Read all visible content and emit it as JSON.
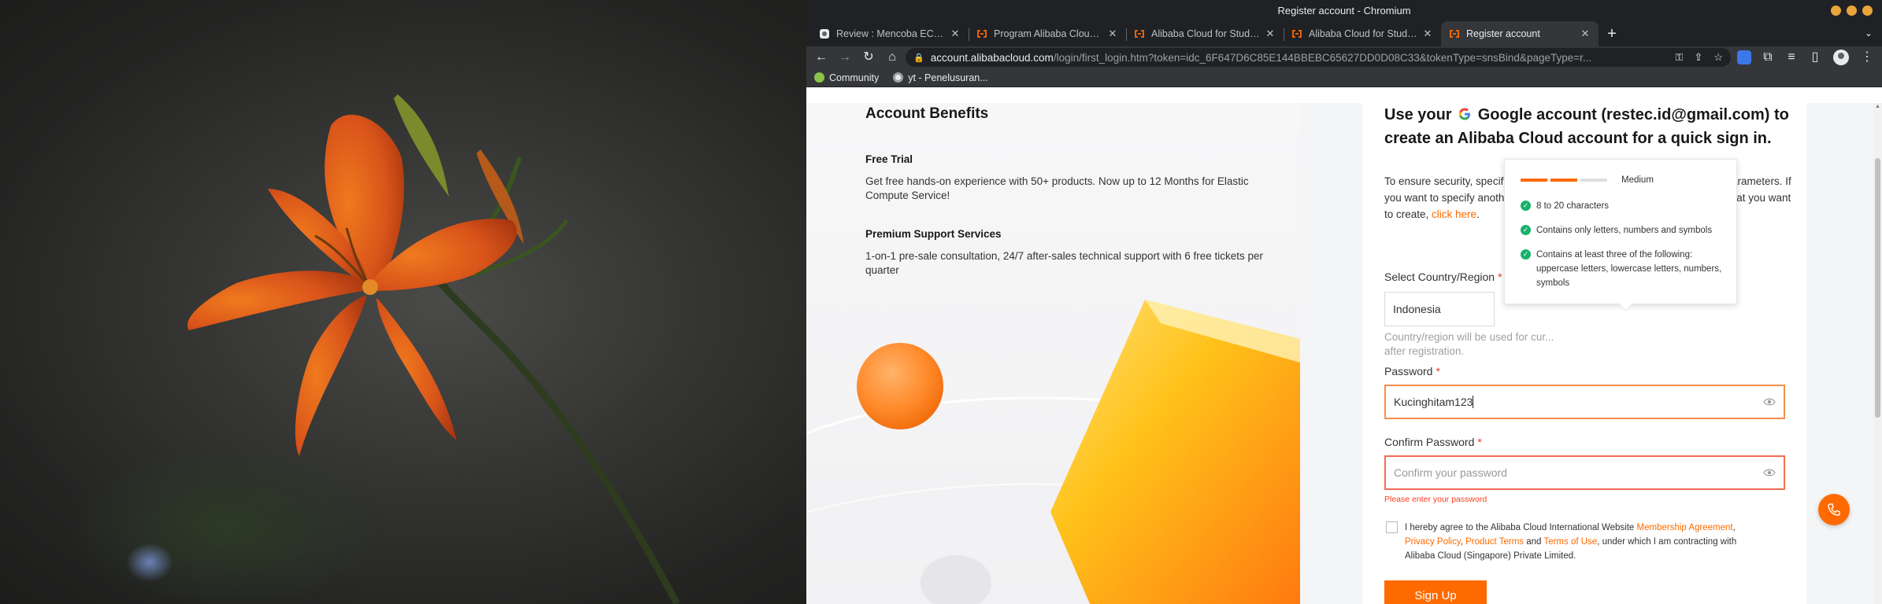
{
  "window": {
    "title": "Register account - Chromium"
  },
  "tabs": [
    {
      "title": "Review : Mencoba ECS atau V",
      "icon": "review-site-icon",
      "active": false
    },
    {
      "title": "Program Alibaba Cloud untuk",
      "icon": "alibaba-cloud-icon",
      "active": false
    },
    {
      "title": "Alibaba Cloud for Students - I",
      "icon": "alibaba-cloud-icon",
      "active": false
    },
    {
      "title": "Alibaba Cloud for Students - I",
      "icon": "alibaba-cloud-icon",
      "active": false
    },
    {
      "title": "Register account",
      "icon": "alibaba-cloud-icon",
      "active": true
    }
  ],
  "address_bar": {
    "host": "account.alibabacloud.com",
    "path": "/login/first_login.htm?token=idc_6F647D6C85E144BBEBC65627DD0D08C33&tokenType=snsBind&pageType=r..."
  },
  "bookmarks": [
    {
      "label": "Community",
      "icon": "community-icon"
    },
    {
      "label": "yt - Penelusuran...",
      "icon": "google-icon"
    }
  ],
  "benefits": {
    "heading": "Account Benefits",
    "items": [
      {
        "title": "Free Trial",
        "text": "Get free hands-on experience with 50+ products. Now up to 12 Months for Elastic Compute Service!"
      },
      {
        "title": "Premium Support Services",
        "text": "1-on-1 pre-sale consultation, 24/7 after-sales technical support with 6 free tickets per quarter"
      }
    ]
  },
  "form": {
    "heading_prefix": "Use your",
    "heading_rest": "Google account (restec.id@gmail.com) to create an Alibaba Cloud account for a quick sign in.",
    "intro": "To ensure security, specify values for the Country/Region and Password parameters. If you want to specify another email address for the Alibaba Cloud account that you want to create,",
    "intro_link": "click here",
    "country_label": "Select Country/Region",
    "country_value": "Indonesia",
    "country_hint": "Country/region will be used for cur... after registration.",
    "password_label": "Password",
    "password_value": "Kucinghitam123",
    "confirm_label": "Confirm Password",
    "confirm_placeholder": "Confirm your password",
    "confirm_error": "Please enter your password",
    "agree_text_1": "I hereby agree to the Alibaba Cloud International Website",
    "agree_link_1": "Membership Agreement",
    "agree_link_2": "Privacy Policy",
    "agree_link_3": "Product Terms",
    "agree_and": "and",
    "agree_link_4": "Terms of Use",
    "agree_text_2": ", under which I am contracting with Alibaba Cloud (Singapore) Private Limited.",
    "signup_label": "Sign Up"
  },
  "password_strength": {
    "level_label": "Medium",
    "level_fraction": 0.67,
    "rules": [
      "8 to 20 characters",
      "Contains only letters, numbers and symbols",
      "Contains at least three of the following: uppercase letters, lowercase letters, numbers, symbols"
    ]
  },
  "colors": {
    "accent": "#ff6a00",
    "error": "#ff3b1f",
    "success": "#17b26a"
  }
}
